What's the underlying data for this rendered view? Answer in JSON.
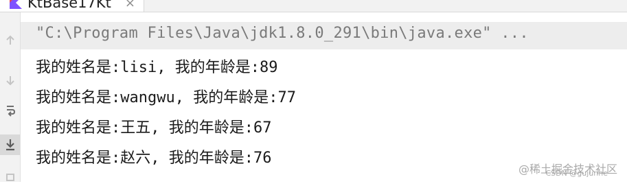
{
  "editor_tab": {
    "label": "KtBase17Kt",
    "close_glyph": "×",
    "icon": "kotlin-file-icon"
  },
  "gutter": {
    "buttons": [
      {
        "icon": "rerun-icon",
        "glyph": "↑"
      },
      {
        "icon": "stop-icon",
        "glyph": "↓"
      },
      {
        "icon": "soft-wrap-icon",
        "glyph": "⇌"
      },
      {
        "icon": "scroll-to-end-icon",
        "glyph": "⤓"
      },
      {
        "icon": "print-icon",
        "glyph": "▤"
      }
    ]
  },
  "console": {
    "command": "\"C:\\Program Files\\Java\\jdk1.8.0_291\\bin\\java.exe\" ...",
    "output_lines": [
      "我的姓名是:lisi, 我的年龄是:89",
      "我的姓名是:wangwu, 我的年龄是:77",
      "我的姓名是:王五, 我的年龄是:67",
      "我的姓名是:赵六, 我的年龄是:76"
    ]
  },
  "watermarks": {
    "main": "@稀土掘金技术社区",
    "csdn": "CSDN @gujunhe"
  },
  "colors": {
    "command_bg": "#ededed",
    "command_text": "#7a7a7a",
    "output_text": "#1a1a1a",
    "kotlin_orange": "#e44857",
    "kotlin_blue": "#7f52ff"
  }
}
